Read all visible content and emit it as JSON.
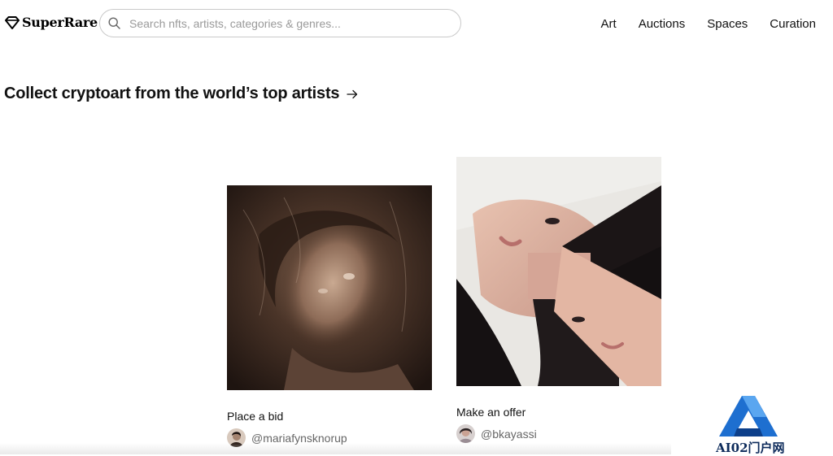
{
  "brand": {
    "name": "SuperRare"
  },
  "search": {
    "placeholder": "Search nfts, artists, categories & genres..."
  },
  "nav": {
    "items": [
      "Art",
      "Auctions",
      "Spaces",
      "Curation"
    ]
  },
  "headline": {
    "text": "Collect cryptoart from the world’s top artists"
  },
  "cards": [
    {
      "action": "Place a bid",
      "artist": "@mariafynsknorup"
    },
    {
      "action": "Make an offer",
      "artist": "@bkayassi"
    }
  ],
  "watermark": {
    "text": "AI02门户网"
  },
  "colors": {
    "text": "#111111",
    "muted": "#666666",
    "border": "#c9c9c9",
    "watermark_blue": "#1e6fd0"
  }
}
